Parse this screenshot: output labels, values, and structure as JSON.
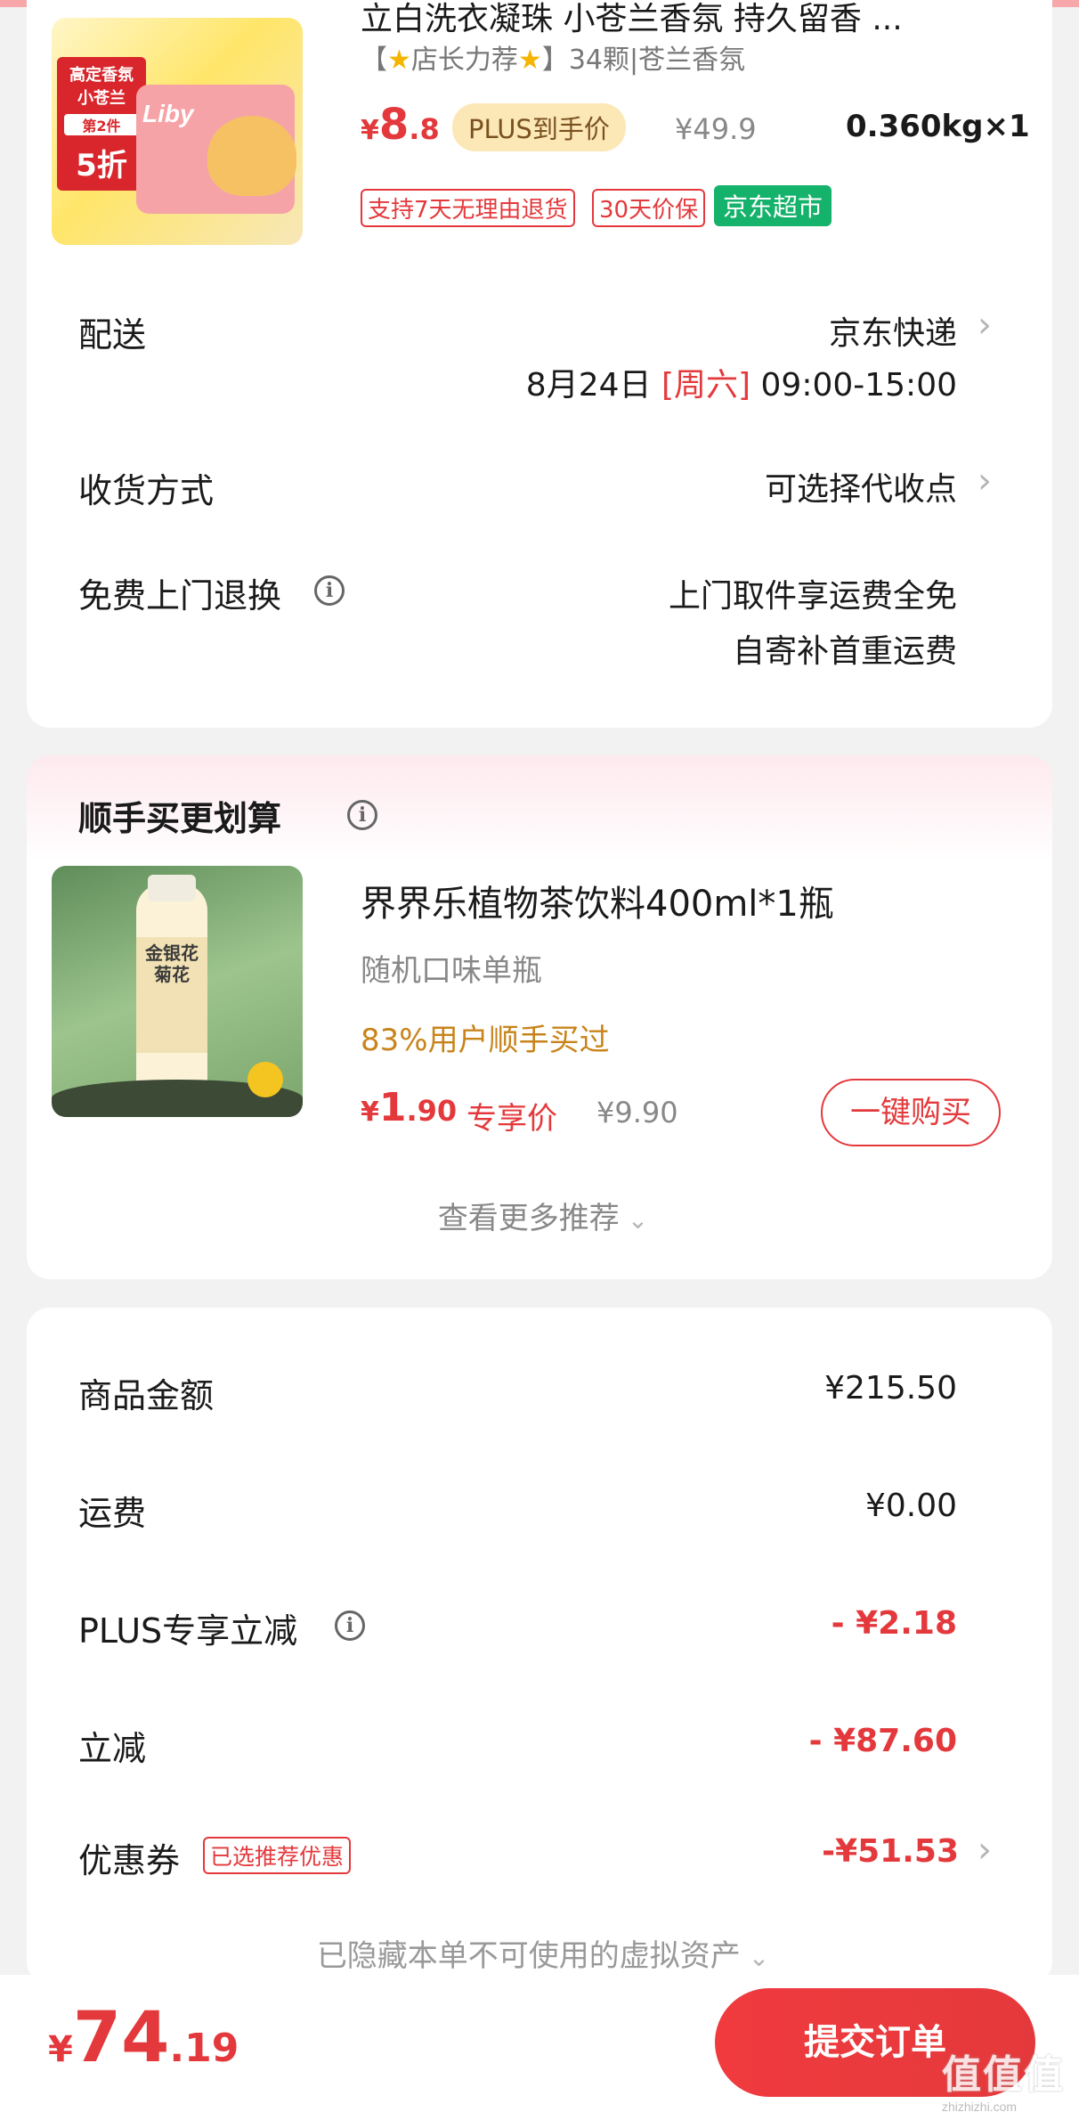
{
  "product": {
    "title": "立白洗衣凝珠 小苍兰香氛 持久留香 ...",
    "recommend_prefix": "【",
    "recommend_text": "店长力荐",
    "recommend_suffix": "】",
    "spec": "34颗|苍兰香氛",
    "price_symbol": "¥",
    "price_int": "8",
    "price_dec": ".8",
    "plus_label": "PLUS到手价",
    "original_price": "¥49.9",
    "weight_qty": "0.360kg×1",
    "tags": [
      "支持7天无理由退货",
      "30天价保"
    ],
    "store_tag": "京东超市",
    "image_texts": [
      "高定香氛",
      "小苍兰",
      "第2件",
      "5折",
      "Liby"
    ]
  },
  "delivery": {
    "label": "配送",
    "carrier": "京东快递",
    "date": "8月24日",
    "weekday": "[周六]",
    "time": "09:00-15:00"
  },
  "receive": {
    "label": "收货方式",
    "value": "可选择代收点"
  },
  "free_return": {
    "label": "免费上门退换",
    "line1": "上门取件享运费全免",
    "line2": "自寄补首重运费"
  },
  "addon": {
    "header": "顺手买更划算",
    "product_title": "界界乐植物茶饮料400ml*1瓶",
    "product_sub": "随机口味单瓶",
    "popularity": "83%用户顺手买过",
    "price_symbol": "¥",
    "price_int": "1",
    "price_dec": ".90",
    "exclusive_label": "专享价",
    "original_price": "¥9.90",
    "buy_button": "一键购买",
    "more": "查看更多推荐",
    "image_text": "金银花菊花"
  },
  "summary": {
    "goods_label": "商品金额",
    "goods_value": "¥215.50",
    "shipping_label": "运费",
    "shipping_value": "¥0.00",
    "plus_label": "PLUS专享立减",
    "plus_value": "- ¥2.18",
    "discount_label": "立减",
    "discount_value": "- ¥87.60",
    "coupon_label": "优惠券",
    "coupon_badge": "已选推荐优惠",
    "coupon_value": "-¥51.53",
    "hidden_assets": "已隐藏本单不可使用的虚拟资产"
  },
  "bottom": {
    "total_symbol": "¥",
    "total_int": "74",
    "total_dec": ".19",
    "submit": "提交订单"
  },
  "watermark": {
    "big": "值值值",
    "small": "zhizhizhi.com"
  },
  "colors": {
    "accent_red": "#e4393c",
    "plus_gold_bg": "#fce7b7",
    "store_green": "#15b26b",
    "popularity_orange": "#c8841b"
  }
}
